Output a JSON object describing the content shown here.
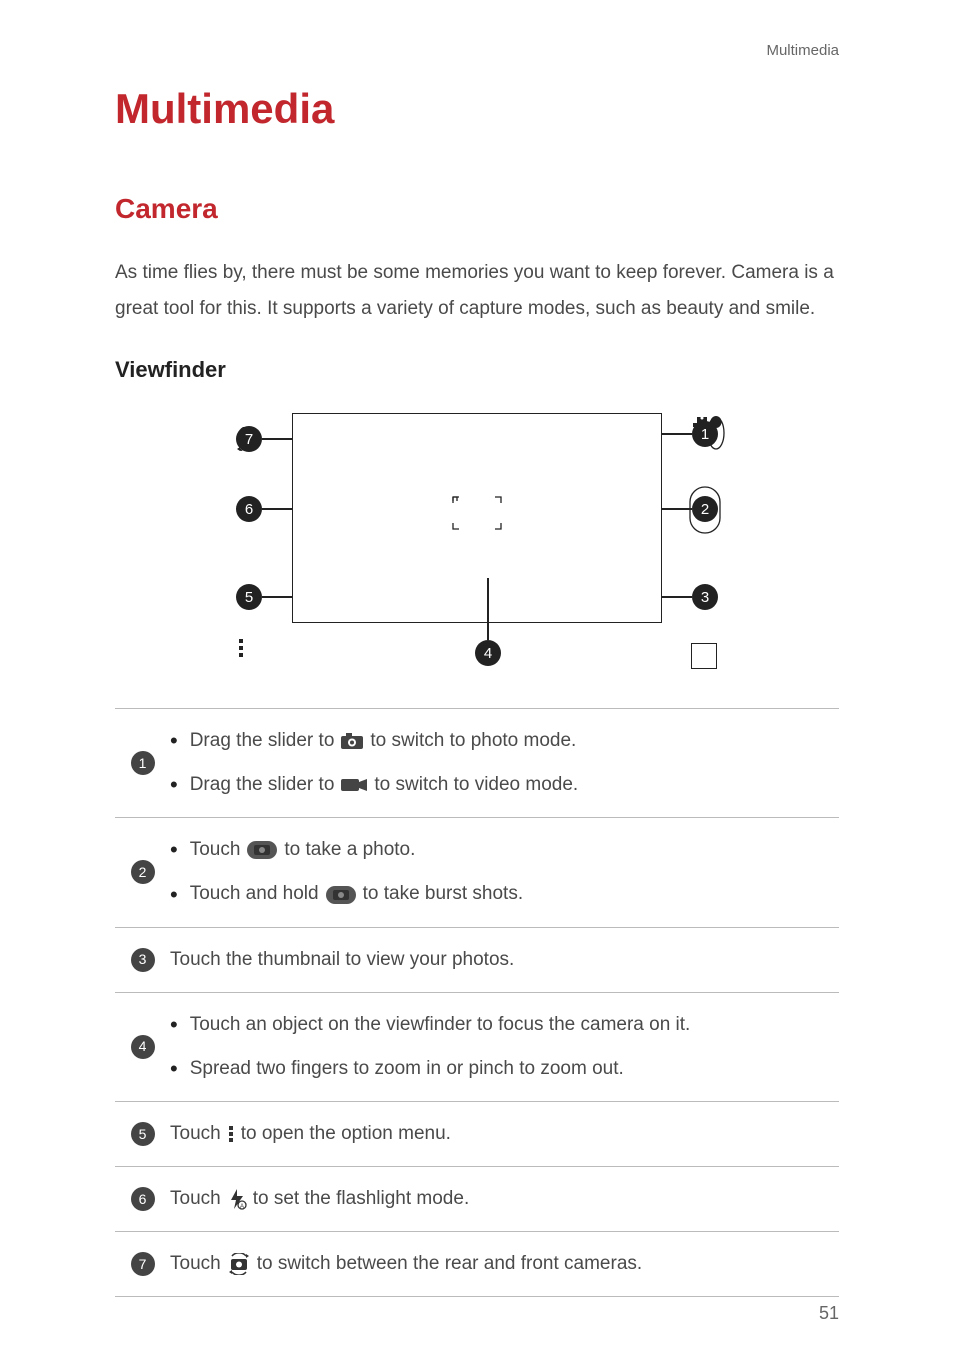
{
  "header_link": "Multimedia",
  "title": "Multimedia",
  "section": "Camera",
  "intro": "As time flies by, there must be some memories you want to keep forever. Camera is a great tool for this. It supports a variety of capture modes, such as beauty and smile.",
  "subsection": "Viewfinder",
  "diagram": {
    "callouts": [
      "1",
      "2",
      "3",
      "4",
      "5",
      "6",
      "7"
    ]
  },
  "legend": [
    {
      "num": "1",
      "lines": [
        {
          "bullet": true,
          "parts": [
            "Drag the slider to ",
            {
              "icon": "photo-mode"
            },
            " to switch to photo mode."
          ]
        },
        {
          "bullet": true,
          "parts": [
            "Drag the slider to ",
            {
              "icon": "video-mode"
            },
            " to switch to video mode."
          ]
        }
      ]
    },
    {
      "num": "2",
      "lines": [
        {
          "bullet": true,
          "parts": [
            "Touch ",
            {
              "icon": "shutter"
            },
            " to take a photo."
          ]
        },
        {
          "bullet": true,
          "parts": [
            "Touch and hold ",
            {
              "icon": "shutter"
            },
            " to take burst shots."
          ]
        }
      ]
    },
    {
      "num": "3",
      "lines": [
        {
          "bullet": false,
          "parts": [
            "Touch the thumbnail to view your photos."
          ]
        }
      ]
    },
    {
      "num": "4",
      "lines": [
        {
          "bullet": true,
          "parts": [
            "Touch an object on the viewfinder to focus the camera on it."
          ]
        },
        {
          "bullet": true,
          "parts": [
            "Spread two fingers to zoom in or pinch to zoom out."
          ]
        }
      ]
    },
    {
      "num": "5",
      "lines": [
        {
          "bullet": false,
          "parts": [
            "Touch ",
            {
              "icon": "menu-dots"
            },
            " to open the option menu."
          ]
        }
      ]
    },
    {
      "num": "6",
      "lines": [
        {
          "bullet": false,
          "parts": [
            "Touch ",
            {
              "icon": "flash"
            },
            " to set the flashlight mode."
          ]
        }
      ]
    },
    {
      "num": "7",
      "lines": [
        {
          "bullet": false,
          "parts": [
            "Touch ",
            {
              "icon": "switch-camera"
            },
            " to switch between the rear and front cameras."
          ]
        }
      ]
    }
  ],
  "page_number": "51"
}
